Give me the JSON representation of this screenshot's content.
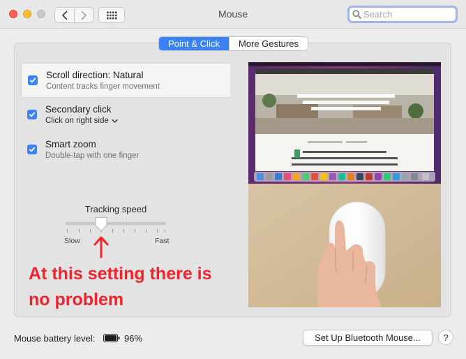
{
  "window": {
    "title": "Mouse"
  },
  "search": {
    "placeholder": "Search"
  },
  "tabs": {
    "point_click": "Point & Click",
    "more_gestures": "More Gestures"
  },
  "options": [
    {
      "title": "Scroll direction: Natural",
      "subtitle": "Content tracks finger movement",
      "checked": true
    },
    {
      "title": "Secondary click",
      "subtitle": "Click on right side",
      "checked": true
    },
    {
      "title": "Smart zoom",
      "subtitle": "Double-tap with one finger",
      "checked": true
    }
  ],
  "tracking": {
    "label": "Tracking speed",
    "slow": "Slow",
    "fast": "Fast",
    "value_fraction": 0.35
  },
  "annotation": {
    "line1": "At this setting there is",
    "line2": "no problem"
  },
  "battery": {
    "label": "Mouse battery level:",
    "percent": "96%"
  },
  "buttons": {
    "bluetooth": "Set Up Bluetooth Mouse...",
    "help": "?"
  },
  "colors": {
    "accent": "#3b82f6",
    "annotation": "#f2232b"
  }
}
